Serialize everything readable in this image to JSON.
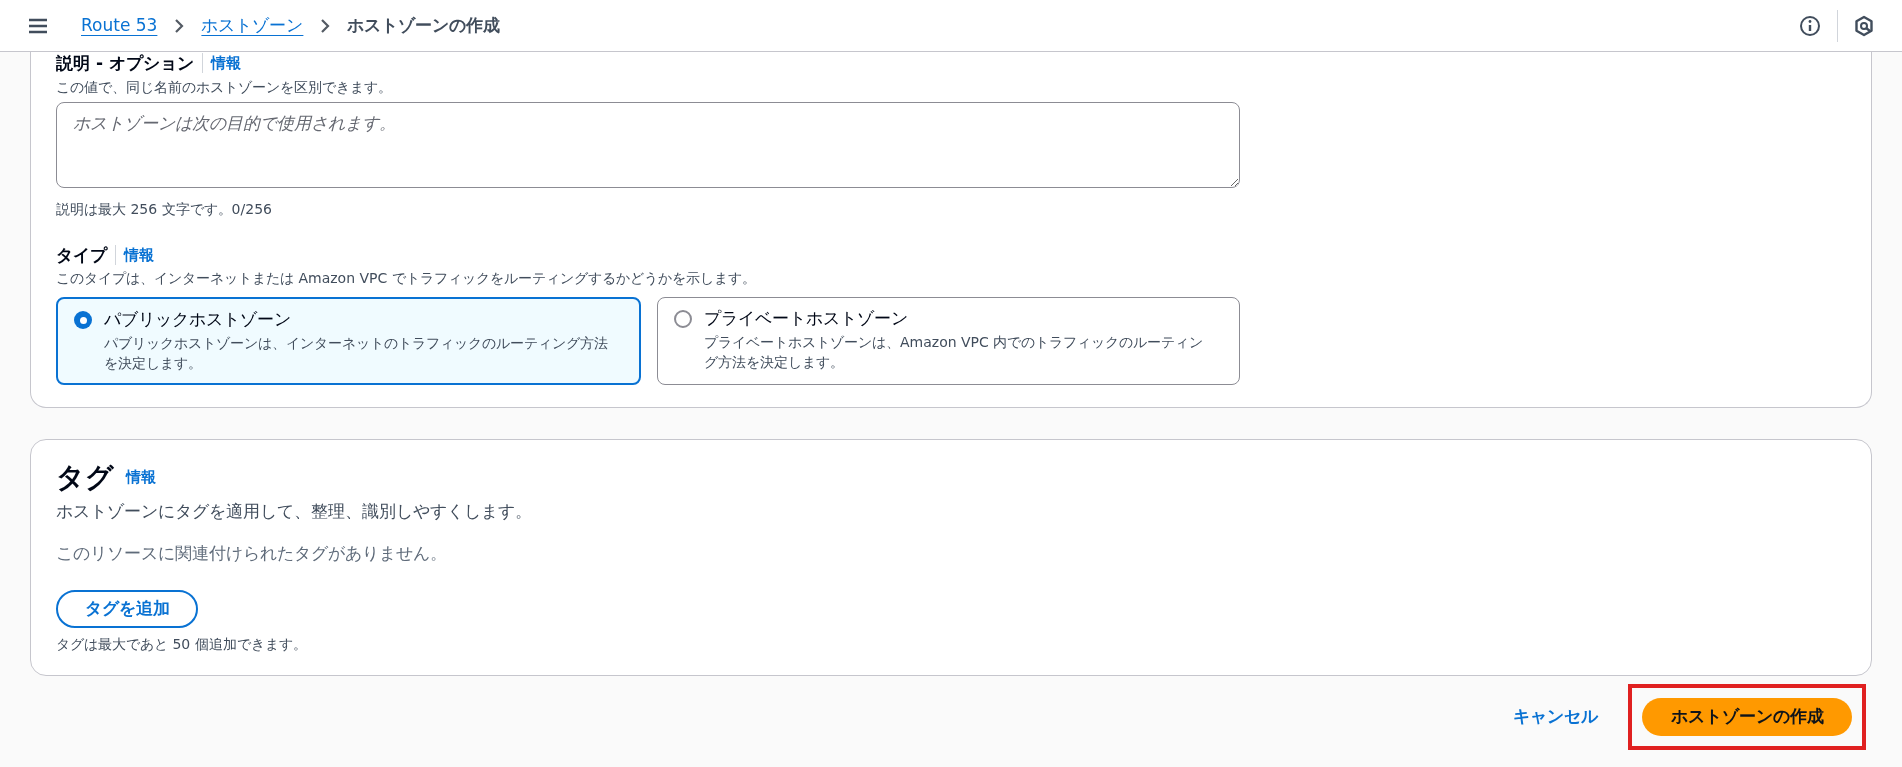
{
  "header": {
    "breadcrumbs": [
      {
        "label": "Route 53",
        "link": true
      },
      {
        "label": "ホストゾーン",
        "link": true
      },
      {
        "label": "ホストゾーンの作成",
        "link": false
      }
    ]
  },
  "description": {
    "label": "説明 - オプション",
    "info": "情報",
    "hint": "この値で、同じ名前のホストゾーンを区別できます。",
    "placeholder": "ホストゾーンは次の目的で使用されます。",
    "constraint": "説明は最大 256 文字です。0/256"
  },
  "type": {
    "label": "タイプ",
    "info": "情報",
    "hint": "このタイプは、インターネットまたは Amazon VPC でトラフィックをルーティングするかどうかを示します。",
    "options": [
      {
        "title": "パブリックホストゾーン",
        "description": "パブリックホストゾーンは、インターネットのトラフィックのルーティング方法を決定します。",
        "selected": true
      },
      {
        "title": "プライベートホストゾーン",
        "description": "プライベートホストゾーンは、Amazon VPC 内でのトラフィックのルーティング方法を決定します。",
        "selected": false
      }
    ]
  },
  "tags": {
    "title": "タグ",
    "info": "情報",
    "description": "ホストゾーンにタグを適用して、整理、識別しやすくします。",
    "empty": "このリソースに関連付けられたタグがありません。",
    "add_button": "タグを追加",
    "limit": "タグは最大であと 50 個追加できます。"
  },
  "footer": {
    "cancel": "キャンセル",
    "create": "ホストゾーンの作成",
    "create_highlighted": true
  }
}
